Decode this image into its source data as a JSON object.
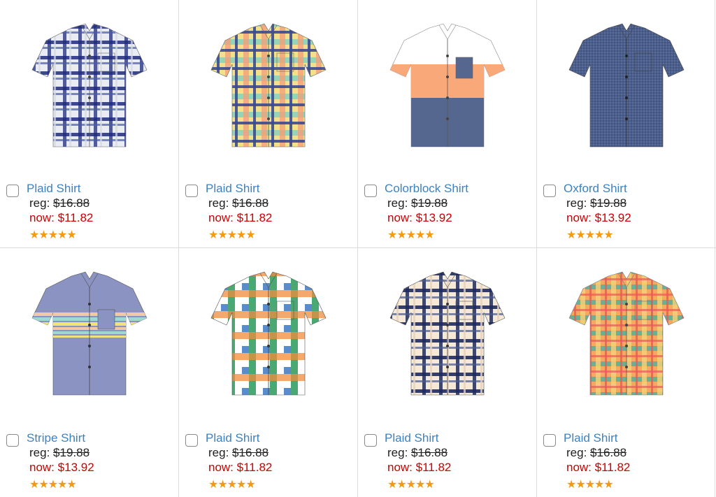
{
  "colors": {
    "link": "#3b82c4",
    "sale": "#cc0000",
    "star": "#f29a14",
    "divider": "#dcdcdc"
  },
  "products": [
    {
      "name": "Plaid Shirt",
      "reg_label": "reg:",
      "reg_price": "$16.88",
      "now_label": "now:",
      "now_price": "$11.82",
      "stars": "★★★★★",
      "rating": 5,
      "swatch": {
        "base": "#e9ecf2",
        "c1": "#1f2a7a",
        "c2": "#4a5aa8",
        "c3": "#d9dbe2"
      }
    },
    {
      "name": "Plaid Shirt",
      "reg_label": "reg:",
      "reg_price": "$16.88",
      "now_label": "now:",
      "now_price": "$11.82",
      "stars": "★★★★★",
      "rating": 5,
      "swatch": {
        "base": "#f4e08a",
        "c1": "#3b4a8f",
        "c2": "#f3a07a",
        "c3": "#7fcfc0"
      }
    },
    {
      "name": "Colorblock Shirt",
      "reg_label": "reg:",
      "reg_price": "$19.88",
      "now_label": "now:",
      "now_price": "$13.92",
      "stars": "★★★★★",
      "rating": 5,
      "swatch": {
        "base": "#ffffff",
        "c1": "#f9a87a",
        "c2": "#56678f",
        "c3": "#56678f"
      }
    },
    {
      "name": "Oxford Shirt",
      "reg_label": "reg:",
      "reg_price": "$19.88",
      "now_label": "now:",
      "now_price": "$13.92",
      "stars": "★★★★★",
      "rating": 5,
      "swatch": {
        "base": "#4c5f8c",
        "c1": "#5a6c98",
        "c2": "#43557f",
        "c3": "#5a6c98"
      }
    },
    {
      "name": "Stripe Shirt",
      "reg_label": "reg:",
      "reg_price": "$19.88",
      "now_label": "now:",
      "now_price": "$13.92",
      "stars": "★★★★★",
      "rating": 5,
      "swatch": {
        "base": "#8a93c2",
        "c1": "#f6c7a6",
        "c2": "#9fd8cf",
        "c3": "#f3e27a"
      }
    },
    {
      "name": "Plaid Shirt",
      "reg_label": "reg:",
      "reg_price": "$16.88",
      "now_label": "now:",
      "now_price": "$11.82",
      "stars": "★★★★★",
      "rating": 5,
      "swatch": {
        "base": "#ffffff",
        "c1": "#2a9a5a",
        "c2": "#f08a3a",
        "c3": "#3b78c4"
      }
    },
    {
      "name": "Plaid Shirt",
      "reg_label": "reg:",
      "reg_price": "$16.88",
      "now_label": "now:",
      "now_price": "$11.82",
      "stars": "★★★★★",
      "rating": 5,
      "swatch": {
        "base": "#f6e9d8",
        "c1": "#1f2a5a",
        "c2": "#4a5a8a",
        "c3": "#e9d2b8"
      }
    },
    {
      "name": "Plaid Shirt",
      "reg_label": "reg:",
      "reg_price": "$16.88",
      "now_label": "now:",
      "now_price": "$11.82",
      "stars": "★★★★★",
      "rating": 5,
      "swatch": {
        "base": "#f7a860",
        "c1": "#4cb0a0",
        "c2": "#f3d37a",
        "c3": "#e85a5a"
      }
    }
  ]
}
